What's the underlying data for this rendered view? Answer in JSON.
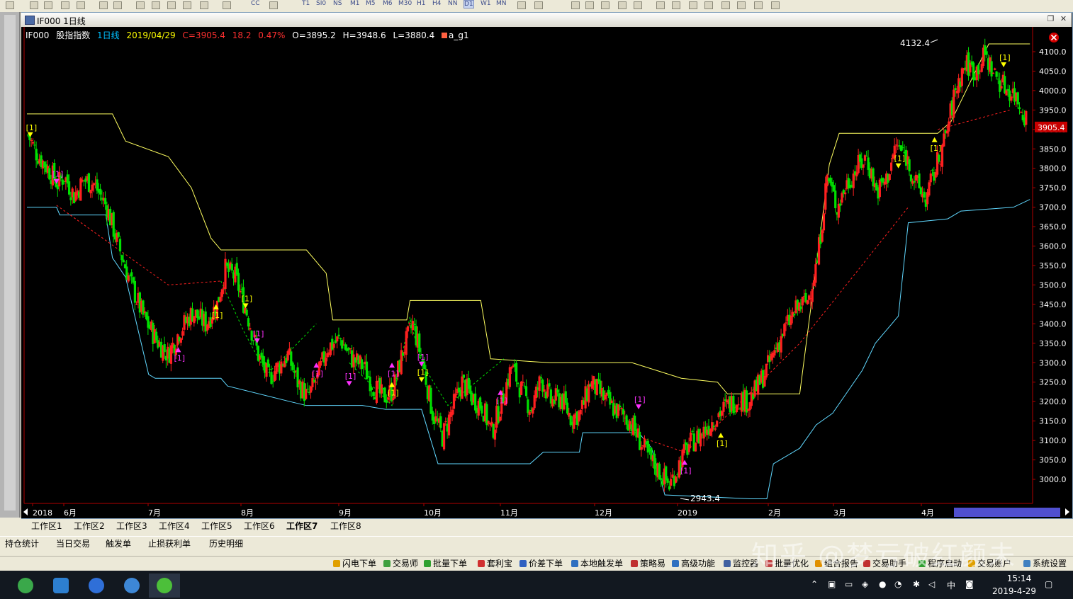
{
  "toolbar": {
    "periods": [
      "T1",
      "SI0",
      "NS",
      "M1",
      "M5",
      "M6",
      "M30",
      "H1",
      "H4",
      "NN",
      "D1",
      "W1",
      "MN"
    ],
    "active_period": "D1",
    "cc_label": "CC"
  },
  "window": {
    "title": "IF000 1日线",
    "restore_glyph": "❐",
    "close_glyph": "✕"
  },
  "info": {
    "symbol": "IF000",
    "name": "股指指数",
    "period": "1日线",
    "date": "2019/04/29",
    "close": "C=3905.4",
    "change": "18.2",
    "pct": "0.47%",
    "open": "O=3895.2",
    "high": "H=3948.6",
    "low": "L=3880.4",
    "indicator": "a_g1",
    "colors": {
      "symbol": "#ffffff",
      "period": "#00c0ff",
      "date": "#ffff00",
      "up": "#ff3030",
      "ohlc": "#ffffff",
      "indicator_box": "#ff6040"
    }
  },
  "chart_data": {
    "type": "candlestick",
    "y_ticks": [
      "4100.0",
      "4050.0",
      "4000.0",
      "3950.0",
      "3900.0",
      "3850.0",
      "3800.0",
      "3750.0",
      "3700.0",
      "3650.0",
      "3600.0",
      "3550.0",
      "3500.0",
      "3450.0",
      "3400.0",
      "3350.0",
      "3300.0",
      "3250.0",
      "3200.0",
      "3150.0",
      "3100.0",
      "3050.0",
      "3000.0"
    ],
    "ylim": [
      2935,
      4130
    ],
    "x_labels": [
      "2018",
      "6月",
      "7月",
      "8月",
      "9月",
      "10月",
      "11月",
      "12月",
      "2019",
      "2月",
      "3月",
      "4月"
    ],
    "high_label": "4132.4",
    "low_label": "2943.4",
    "last_price": "3905.4",
    "signal_label": "[1]",
    "colors": {
      "up": "#ff2020",
      "down": "#00e000",
      "upper_channel": "#ffff60",
      "lower_channel": "#60d8ff",
      "zigzag_red": "#ff2020",
      "zigzag_green": "#00e000",
      "buy": "#ffff00",
      "sell": "#ff30ff",
      "price_tag_bg": "#c80000"
    }
  },
  "workspace_tabs": [
    "工作区1",
    "工作区2",
    "工作区3",
    "工作区4",
    "工作区5",
    "工作区6",
    "工作区7",
    "工作区8"
  ],
  "active_workspace": "工作区7",
  "bottom_tabs": [
    "持仓统计",
    "当日交易",
    "触发单",
    "止损获利单",
    "历史明细"
  ],
  "function_bar": [
    "闪电下单",
    "交易师",
    "批量下单",
    "套利宝",
    "价差下单",
    "本地触发单",
    "策略易",
    "高级功能",
    "监控器",
    "批量优化",
    "组合报告",
    "交易助手",
    "程序启动",
    "交易账户",
    "系统设置"
  ],
  "watermark": "知乎 @梦亏破红颜未",
  "taskbar": {
    "time": "15:14",
    "date": "2019-4-29",
    "ime": "中"
  }
}
